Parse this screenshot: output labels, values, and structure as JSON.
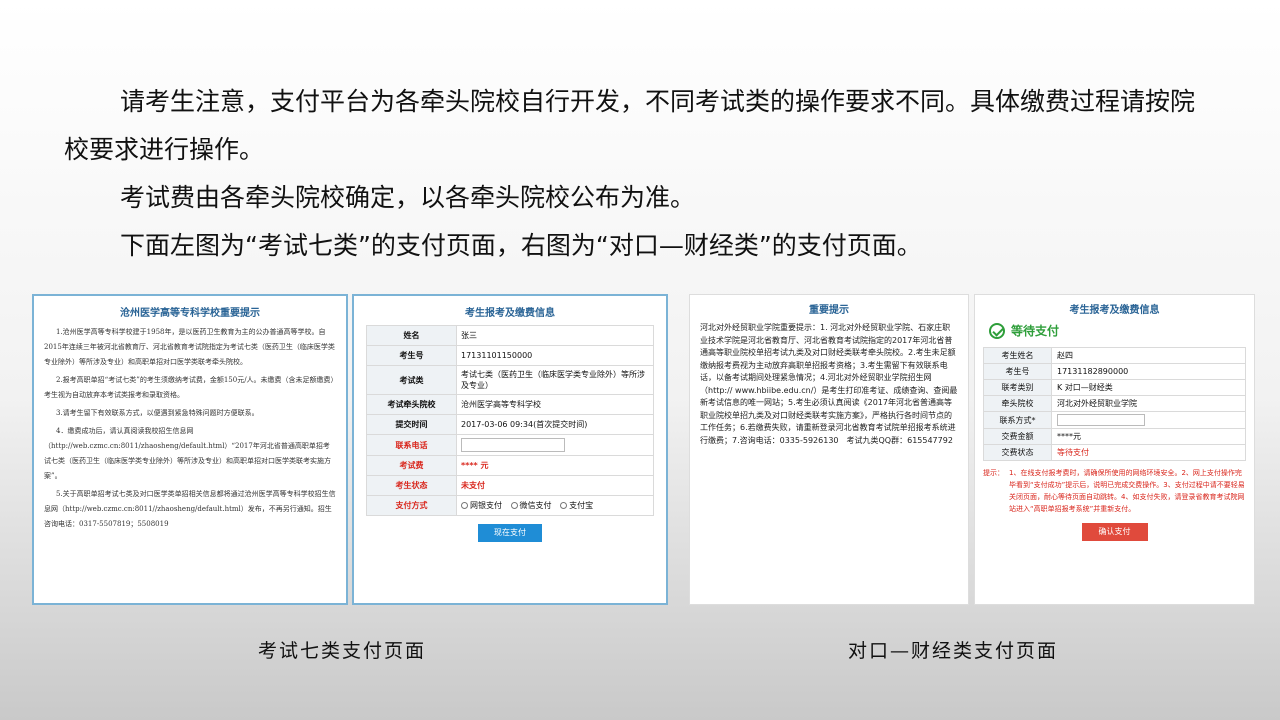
{
  "intro": {
    "line1": "请考生注意，支付平台为各牵头院校自行开发，不同考试类的操作要求不同。具体缴费过程请按院校要求进行操作。",
    "line2": "考试费由各牵头院校确定，以各牵头院校公布为准。",
    "line3": "下面左图为“考试七类”的支付页面，右图为“对口—财经类”的支付页面。"
  },
  "left_notice": {
    "title": "沧州医学高等专科学校重要提示",
    "p1": "1.沧州医学高等专科学校建于1958年，是以医药卫生教育为主的公办普通高等学校。自2015年连续三年被河北省教育厅、河北省教育考试院指定为考试七类（医药卫生（临床医学类专业除外）等所涉及专业）和高职单招对口医学类联考牵头院校。",
    "p2": "2.报考高职单招“考试七类”的考生须缴纳考试费，金额150元/人。未缴费（含未足额缴费）考生视为自动放弃本考试类报考和录取资格。",
    "p3": "3.请考生留下有效联系方式，以便遇到紧急特殊问题时方便联系。",
    "p4": "4．缴费成功后，请认真阅读我校招生信息网（http://web.czmc.cn:8011/zhaosheng/default.html）“2017年河北省普通高职单招考试七类（医药卫生（临床医学类专业除外）等所涉及专业）和高职单招对口医学类联考实施方案”。",
    "p5": "5.关于高职单招考试七类及对口医学类单招相关信息都将通过沧州医学高等专科学校招生信息网（http://web.czmc.cn:8011//zhaosheng/default.html）发布，不再另行通知。招生咨询电话：0317-5507819；5508019"
  },
  "left_form": {
    "title": "考生报考及缴费信息",
    "rows": [
      {
        "label": "姓名",
        "value": "张三"
      },
      {
        "label": "考生号",
        "value": "17131101150000"
      },
      {
        "label": "考试类",
        "value": "考试七类（医药卫生（临床医学类专业除外）等所涉及专业）"
      },
      {
        "label": "考试牵头院校",
        "value": "沧州医学高等专科学校"
      },
      {
        "label": "提交时间",
        "value": "2017-03-06 09:34(首次提交时间)"
      }
    ],
    "contact_label": "联系电话",
    "fee_label": "考试费",
    "fee_value": "**** 元",
    "status_label": "考生状态",
    "status_value": "未支付",
    "pay_label": "支付方式",
    "pay_options": [
      "网银支付",
      "微信支付",
      "支付宝"
    ],
    "pay_button": "现在支付"
  },
  "right_notice": {
    "title": "重要提示",
    "body": "河北对外经贸职业学院重要提示：1. 河北对外经贸职业学院、石家庄职业技术学院是河北省教育厅、河北省教育考试院指定的2017年河北省普通高等职业院校单招考试九类及对口财经类联考牵头院校。2.考生未足额缴纳报考费视为主动放弃高职单招报考资格；3.考生需留下有效联系电话，以备考试期间处理紧急情况；4.河北对外经贸职业学院招生网（http:// www.hbiibe.edu.cn/）是考生打印准考证、成绩查询、查阅最新考试信息的唯一网站；5.考生必须认真阅读《2017年河北省普通高等职业院校单招九类及对口财经类联考实施方案》，严格执行各时间节点的工作任务；6.若缴费失败，请重新登录河北省教育考试院单招报考系统进行缴费；7.咨询电话：0335-5926130　考试九类QQ群：615547792"
  },
  "right_form": {
    "title": "考生报考及缴费信息",
    "waiting": "等待支付",
    "rows": [
      {
        "label": "考生姓名",
        "value": "赵四"
      },
      {
        "label": "考生号",
        "value": "17131182890000"
      },
      {
        "label": "联考类别",
        "value": "K 对口—财经类"
      },
      {
        "label": "牵头院校",
        "value": "河北对外经贸职业学院"
      }
    ],
    "contact_label": "联系方式*",
    "fee_label": "交费金额",
    "fee_value": "****元",
    "status_label": "交费状态",
    "status_value": "等待支付",
    "tips_head": "提示：",
    "tips": "1、在线支付报考费时，请确保所使用的网络环境安全。2、网上支付操作完毕看到“支付成功”提示后，说明已完成交费操作。3、支付过程中请不要轻易关闭页面，耐心等待页面自动跳转。4、如支付失败，请登录省教育考试院网站进入“高职单招报考系统”并重新支付。",
    "confirm_button": "确认支付"
  },
  "captions": {
    "left": "考试七类支付页面",
    "right": "对口—财经类支付页面"
  }
}
